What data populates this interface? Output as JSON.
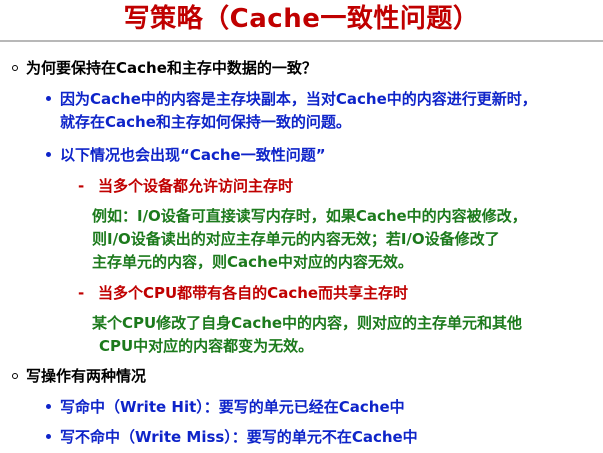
{
  "title": "写策略（Cache一致性问题）",
  "sections": [
    {
      "text": "为何要保持在Cache和主存中数据的一致？",
      "points": [
        {
          "lines": [
            "因为Cache中的内容是主存块副本，当对Cache中的内容进行更新时，",
            "就存在Cache和主存如何保持一致的问题。"
          ]
        },
        {
          "lines": [
            "以下情况也会出现“Cache一致性问题”"
          ],
          "cases": [
            {
              "dash": "-",
              "label": "当多个设备都允许访问主存时",
              "detail": [
                "例如：I/O设备可直接读写内存时，如果Cache中的内容被修改，",
                "则I/O设备读出的对应主存单元的内容无效；若I/O设备修改了",
                "主存单元的内容，则Cache中对应的内容无效。"
              ]
            },
            {
              "dash": "-",
              "label": "当多个CPU都带有各自的Cache而共享主存时",
              "detail": [
                "某个CPU修改了自身Cache中的内容，则对应的主存单元和其他",
                "CPU中对应的内容都变为无效。"
              ]
            }
          ]
        }
      ]
    },
    {
      "text": "写操作有两种情况",
      "points": [
        {
          "lines": [
            "写命中（Write Hit）：要写的单元已经在Cache中"
          ]
        },
        {
          "lines": [
            "写不命中（Write Miss）：要写的单元不在Cache中"
          ]
        }
      ]
    }
  ]
}
